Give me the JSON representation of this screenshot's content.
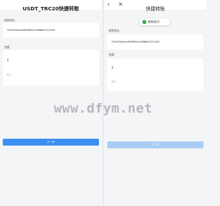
{
  "left": {
    "title": "USDT_TRC20快捷转账",
    "address_label": "收款地址",
    "address": "TV4h4EAdukeHSBG9Wa2zVX9WW4k2Z2tSuM",
    "amount_label": "金额",
    "amount": "1",
    "note_placeholder": "备注",
    "next_label": "下一步"
  },
  "right": {
    "back_icon": "‹",
    "close_icon": "✕",
    "title": "快捷转账",
    "address_label": "收款地址",
    "address": "TV4h4EAdukeHSBG9Wa2zVX9WW4k2Z2tSuM",
    "amount_label": "金额",
    "amount": "1",
    "note_placeholder": "备注",
    "next_label": "下一步",
    "toast": "复制成功",
    "toast_icon": "✓"
  },
  "watermark": "www.dfym.net",
  "colors": {
    "primary_button": "#3b8ff0",
    "primary_button_disabled": "#a9cdf4",
    "success_green": "#2ba54b"
  }
}
